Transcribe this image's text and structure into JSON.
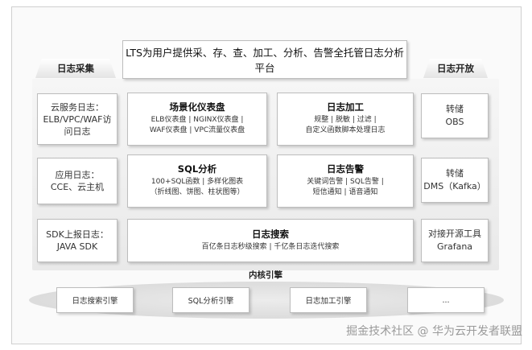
{
  "title": "LTS为用户提供采、存、查、加工、分析、告警全托管日志分析平台",
  "left_header": "日志采集",
  "right_header": "日志开放",
  "collection": [
    {
      "lines": [
        "云服务日志：",
        "ELB/VPC/WAF访",
        "问日志"
      ]
    },
    {
      "lines": [
        "应用日志：",
        "CCE、云主机"
      ]
    },
    {
      "lines": [
        "SDK上报日志：",
        "JAVA SDK"
      ]
    }
  ],
  "opening": [
    {
      "lines": [
        "转储",
        "OBS"
      ]
    },
    {
      "lines": [
        "转储",
        "DMS（Kafka）"
      ]
    },
    {
      "lines": [
        "对接开源工具",
        "Grafana"
      ]
    }
  ],
  "features": {
    "dashboard": {
      "title": "场景化仪表盘",
      "lines": [
        "ELB仪表盘 | NGINX仪表盘 |",
        "WAF仪表盘 | VPC流量仪表盘"
      ]
    },
    "processing": {
      "title": "日志加工",
      "lines": [
        "规整 | 脱敏 | 过滤 |",
        "自定义函数脚本处理日志"
      ]
    },
    "sql": {
      "title": "SQL分析",
      "lines": [
        "100+SQL函数 | 多样化图表",
        "（折线图、饼图、柱状图等）"
      ]
    },
    "alarm": {
      "title": "日志告警",
      "lines": [
        "关键词告警 | SQL告警 |",
        "短信通知 | 语音通知"
      ]
    },
    "search": {
      "title": "日志搜索",
      "lines": [
        "百亿条日志秒级搜索 | 千亿条日志迭代搜索"
      ]
    }
  },
  "kernel": {
    "label": "内核引擎",
    "engines": [
      "日志搜索引擎",
      "SQL分析引擎",
      "日志加工引擎",
      "..."
    ]
  },
  "watermark": "掘金技术社区 @ 华为云开发者联盟"
}
